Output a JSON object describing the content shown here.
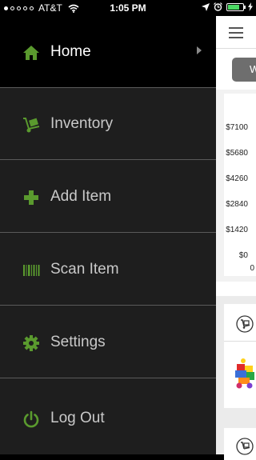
{
  "status": {
    "carrier": "AT&T",
    "time": "1:05 PM",
    "battery_level": 0.8
  },
  "menu": {
    "items": [
      {
        "label": "Home",
        "icon": "home-icon"
      },
      {
        "label": "Inventory",
        "icon": "hand-truck-icon"
      },
      {
        "label": "Add Item",
        "icon": "plus-icon"
      },
      {
        "label": "Scan Item",
        "icon": "barcode-icon"
      },
      {
        "label": "Settings",
        "icon": "gear-icon"
      },
      {
        "label": "Log Out",
        "icon": "power-icon"
      }
    ],
    "active_index": 0
  },
  "main": {
    "segment_label": "W",
    "chart": {
      "y_ticks": [
        "$7100",
        "$5680",
        "$4260",
        "$2840",
        "$1420",
        "$0"
      ],
      "x_first_tick": "0"
    }
  },
  "colors": {
    "accent": "#5a9a2e",
    "menu_bg": "#1e1e1e",
    "active_bg": "#000000"
  }
}
